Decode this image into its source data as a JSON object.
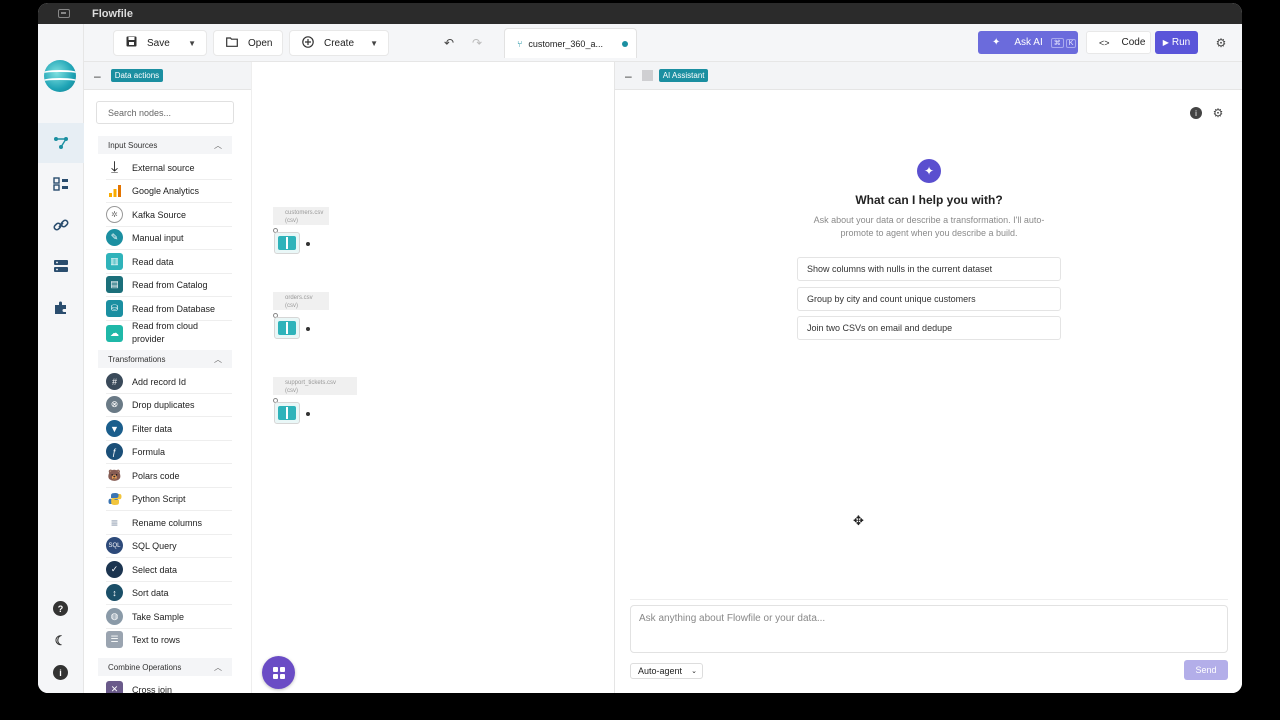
{
  "window": {
    "title": "Flowfile"
  },
  "toolbar": {
    "save_label": "Save",
    "open_label": "Open",
    "create_label": "Create",
    "tab_name": "customer_360_a...",
    "ask_ai_label": "Ask AI",
    "ask_ai_shortcut_1": "⌘",
    "ask_ai_shortcut_2": "K",
    "code_label": "Code",
    "run_label": "Run"
  },
  "left_panel": {
    "title": "Data actions",
    "search_placeholder": "Search nodes...",
    "sections": [
      {
        "label": "Input Sources",
        "items": [
          {
            "label": "External source",
            "icon": "download-icon",
            "color": "#222222"
          },
          {
            "label": "Google Analytics",
            "icon": "google-analytics-icon",
            "color": "#f4a300"
          },
          {
            "label": "Kafka Source",
            "icon": "kafka-icon",
            "color": "#888888"
          },
          {
            "label": "Manual input",
            "icon": "manual-input-icon",
            "color": "#1b8fa1"
          },
          {
            "label": "Read data",
            "icon": "book-icon",
            "color": "#2fb3ba"
          },
          {
            "label": "Read from Catalog",
            "icon": "catalog-icon",
            "color": "#1b6f7a"
          },
          {
            "label": "Read from Database",
            "icon": "database-icon",
            "color": "#1b8fa1"
          },
          {
            "label": "Read from cloud provider",
            "icon": "cloud-icon",
            "color": "#1fb8a8"
          }
        ]
      },
      {
        "label": "Transformations",
        "items": [
          {
            "label": "Add record Id",
            "icon": "record-id-icon",
            "color": "#3a4a5a"
          },
          {
            "label": "Drop duplicates",
            "icon": "drop-duplicates-icon",
            "color": "#6a7a86"
          },
          {
            "label": "Filter data",
            "icon": "filter-icon",
            "color": "#1b5e8c"
          },
          {
            "label": "Formula",
            "icon": "formula-icon",
            "color": "#1b4f78"
          },
          {
            "label": "Polars code",
            "icon": "polars-bear-icon",
            "color": "#8a8a8a"
          },
          {
            "label": "Python Script",
            "icon": "python-icon",
            "color": "#3a74b3"
          },
          {
            "label": "Rename columns",
            "icon": "rename-icon",
            "color": "#7a8aa0"
          },
          {
            "label": "SQL Query",
            "icon": "sql-icon",
            "color": "#2d4a7a"
          },
          {
            "label": "Select data",
            "icon": "select-check-icon",
            "color": "#1c3550"
          },
          {
            "label": "Sort data",
            "icon": "sort-icon",
            "color": "#1b4f68"
          },
          {
            "label": "Take Sample",
            "icon": "sample-icon",
            "color": "#8a9aa8"
          },
          {
            "label": "Text to rows",
            "icon": "text-to-rows-icon",
            "color": "#9aa4b0"
          }
        ]
      },
      {
        "label": "Combine Operations",
        "items": [
          {
            "label": "Cross join",
            "icon": "cross-join-icon",
            "color": "#6a5a8a"
          }
        ]
      }
    ]
  },
  "canvas": {
    "nodes": [
      {
        "name": "customers.csv",
        "type": "(csv)"
      },
      {
        "name": "orders.csv",
        "type": "(csv)"
      },
      {
        "name": "support_tickets.csv",
        "type": "(csv)"
      }
    ]
  },
  "ai_panel": {
    "title": "AI Assistant",
    "heading": "What can I help you with?",
    "subtitle": "Ask about your data or describe a transformation. I'll auto-promote to agent when you describe a build.",
    "suggestions": [
      "Show columns with nulls in the current dataset",
      "Group by city and count unique customers",
      "Join two CSVs on email and dedupe"
    ],
    "input_placeholder": "Ask anything about Flowfile or your data...",
    "mode": "Auto-agent",
    "send_label": "Send"
  },
  "colors": {
    "accent": "#1b8fa1",
    "primary": "#5a55d9",
    "ai": "#6b6bdc"
  }
}
